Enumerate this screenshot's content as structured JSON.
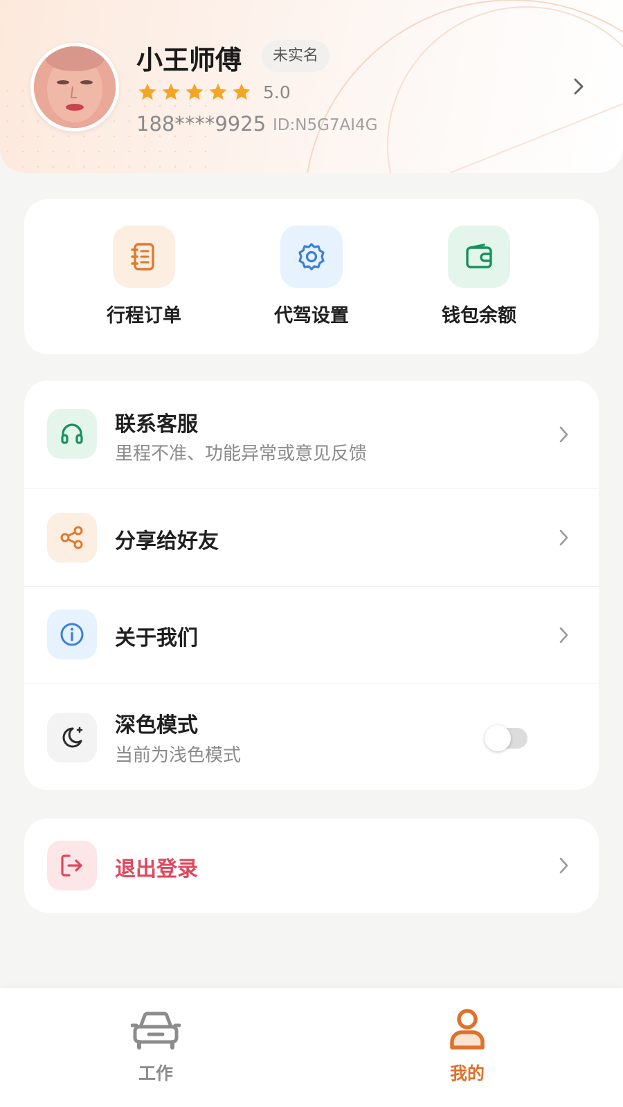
{
  "profile": {
    "name": "小王师傅",
    "verify_badge": "未实名",
    "rating": "5.0",
    "star_count": 5,
    "phone": "188****9925",
    "id": "ID:N5G7AI4G"
  },
  "quick_actions": [
    {
      "label": "行程订单",
      "icon": "notebook-icon",
      "color": "#e0792e",
      "bg": "#fdeee2"
    },
    {
      "label": "代驾设置",
      "icon": "gear-icon",
      "color": "#3b7fd6",
      "bg": "#e6f2fd"
    },
    {
      "label": "钱包余额",
      "icon": "wallet-icon",
      "color": "#16905c",
      "bg": "#e4f5ec"
    }
  ],
  "menu": {
    "support": {
      "title": "联系客服",
      "subtitle": "里程不准、功能异常或意见反馈",
      "icon": "headset-icon"
    },
    "share": {
      "title": "分享给好友",
      "icon": "share-icon"
    },
    "about": {
      "title": "关于我们",
      "icon": "info-icon"
    },
    "dark_mode": {
      "title": "深色模式",
      "subtitle": "当前为浅色模式",
      "enabled": false,
      "icon": "moon-icon"
    }
  },
  "logout": {
    "label": "退出登录",
    "color": "#e0475c",
    "icon": "logout-icon"
  },
  "tabbar": {
    "work": {
      "label": "工作",
      "icon": "car-icon",
      "active": false
    },
    "mine": {
      "label": "我的",
      "icon": "person-icon",
      "active": true
    }
  },
  "colors": {
    "accent": "#e0712a",
    "star": "#f5a524",
    "inactive_tab": "#8c8c8c"
  }
}
